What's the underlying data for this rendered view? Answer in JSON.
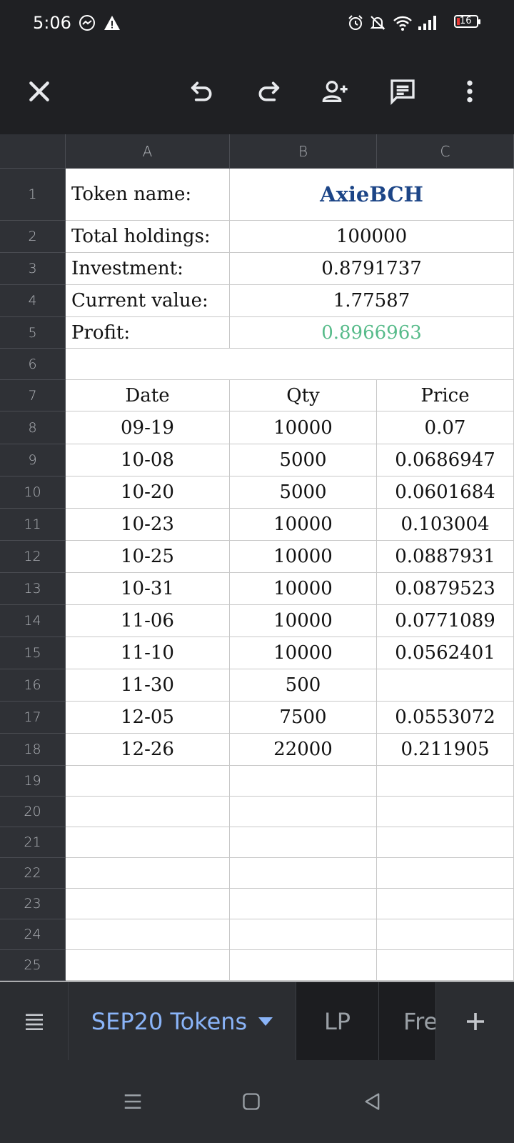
{
  "status": {
    "time": "5:06",
    "battery": "16"
  },
  "toolbar": {
    "close_icon": "close-icon",
    "undo_icon": "undo-icon",
    "redo_icon": "redo-icon",
    "share_icon": "add-person-icon",
    "comment_icon": "comment-icon",
    "more_icon": "more-vert-icon"
  },
  "columns": [
    "A",
    "B",
    "C"
  ],
  "rows": [
    "1",
    "2",
    "3",
    "4",
    "5",
    "6",
    "7",
    "8",
    "9",
    "10",
    "11",
    "12",
    "13",
    "14",
    "15",
    "16",
    "17",
    "18",
    "19",
    "20",
    "21",
    "22",
    "23",
    "24",
    "25"
  ],
  "summary": {
    "token_name_label": "Token name:",
    "token_name_value": "AxieBCH",
    "total_holdings_label": "Total holdings:",
    "total_holdings_value": "100000",
    "investment_label": "Investment:",
    "investment_value": "0.8791737",
    "current_value_label": "Current value:",
    "current_value_value": "1.77587",
    "profit_label": "Profit:",
    "profit_value": "0.8966963"
  },
  "table": {
    "headers": [
      "Date",
      "Qty",
      "Price"
    ],
    "rows": [
      [
        "09-19",
        "10000",
        "0.07"
      ],
      [
        "10-08",
        "5000",
        "0.0686947"
      ],
      [
        "10-20",
        "5000",
        "0.0601684"
      ],
      [
        "10-23",
        "10000",
        "0.103004"
      ],
      [
        "10-25",
        "10000",
        "0.0887931"
      ],
      [
        "10-31",
        "10000",
        "0.0879523"
      ],
      [
        "11-06",
        "10000",
        "0.0771089"
      ],
      [
        "11-10",
        "10000",
        "0.0562401"
      ],
      [
        "11-30",
        "500",
        ""
      ],
      [
        "12-05",
        "7500",
        "0.0553072"
      ],
      [
        "12-26",
        "22000",
        "0.211905"
      ]
    ]
  },
  "colors": {
    "title": "#1c4587",
    "profit": "#57bb8a",
    "active_tab": "#8ab4f8"
  },
  "tabs": {
    "active": "SEP20 Tokens",
    "second": "LP",
    "third": "Fre"
  }
}
